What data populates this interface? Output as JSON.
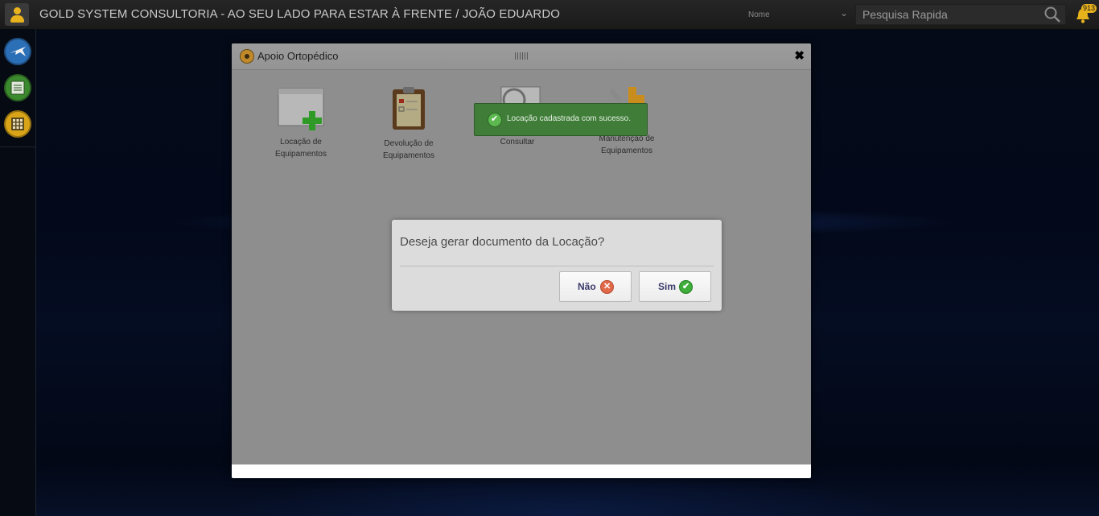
{
  "header": {
    "app_title": "GOLD SYSTEM CONSULTORIA - AO SEU LADO PARA ESTAR À FRENTE / JOÃO EDUARDO",
    "search_filter_selected": "Nome",
    "search_placeholder": "Pesquisa Rapida",
    "notifications_count": "913"
  },
  "sidebar": {
    "items": [
      {
        "icon": "plane-icon",
        "color": "#2b6fb7"
      },
      {
        "icon": "list-icon",
        "color": "#3c8a2e"
      },
      {
        "icon": "calculator-icon",
        "color": "#d9a417"
      }
    ]
  },
  "modal": {
    "title": "Apoio Ortopédico",
    "close_label": "✖",
    "tiles": [
      {
        "label_line1": "Locação de",
        "label_line2": "Equipamentos",
        "icon": "window-plus-icon"
      },
      {
        "label_line1": "Devolução de",
        "label_line2": "Equipamentos",
        "icon": "clipboard-icon"
      },
      {
        "label_line1": "Consultar",
        "label_line2": "",
        "icon": "magnifier-window-icon"
      },
      {
        "label_line1": "Manutenção de",
        "label_line2": "Equipamentos",
        "icon": "tools-icon"
      }
    ]
  },
  "toast": {
    "message": "Locação cadastrada com sucesso."
  },
  "confirm": {
    "question": "Deseja gerar documento da Locação?",
    "no_label": "Não",
    "yes_label": "Sim"
  }
}
